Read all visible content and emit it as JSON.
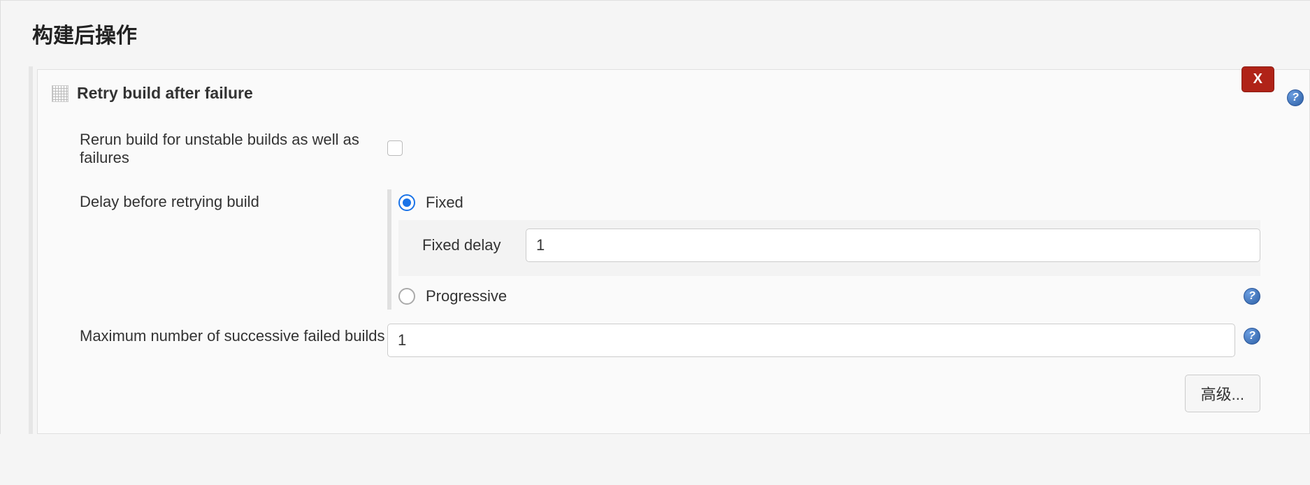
{
  "section": {
    "title": "构建后操作"
  },
  "block": {
    "title": "Retry build after failure",
    "close_label": "X"
  },
  "fields": {
    "rerun_unstable": {
      "label": "Rerun build for unstable builds as well as failures",
      "checked": false
    },
    "delay": {
      "label": "Delay before retrying build",
      "fixed_option": "Fixed",
      "progressive_option": "Progressive",
      "selected": "fixed",
      "fixed_delay_label": "Fixed delay",
      "fixed_delay_value": "1"
    },
    "max_failed": {
      "label": "Maximum number of successive failed builds",
      "value": "1"
    }
  },
  "buttons": {
    "advanced": "高级..."
  }
}
